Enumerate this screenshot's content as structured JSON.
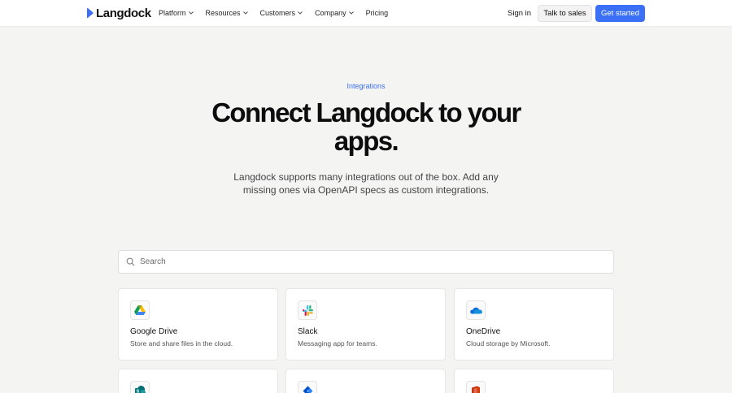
{
  "nav": {
    "logo_text": "Langdock",
    "items": [
      {
        "label": "Platform",
        "has_dropdown": true
      },
      {
        "label": "Resources",
        "has_dropdown": true
      },
      {
        "label": "Customers",
        "has_dropdown": true
      },
      {
        "label": "Company",
        "has_dropdown": true
      },
      {
        "label": "Pricing",
        "has_dropdown": false
      }
    ],
    "sign_in": "Sign in",
    "talk_to_sales": "Talk to sales",
    "get_started": "Get started"
  },
  "hero": {
    "eyebrow": "Integrations",
    "title": "Connect Langdock to your apps.",
    "subtitle": "Langdock supports many integrations out of the box. Add any missing ones via OpenAPI specs as custom integrations."
  },
  "search": {
    "placeholder": "Search"
  },
  "integrations": [
    {
      "name": "Google Drive",
      "description": "Store and share files in the cloud.",
      "icon": "google-drive-icon"
    },
    {
      "name": "Slack",
      "description": "Messaging app for teams.",
      "icon": "slack-icon"
    },
    {
      "name": "OneDrive",
      "description": "Cloud storage by Microsoft.",
      "icon": "onedrive-icon"
    },
    {
      "name": "",
      "description": "",
      "icon": "sharepoint-icon"
    },
    {
      "name": "",
      "description": "",
      "icon": "jira-icon"
    },
    {
      "name": "",
      "description": "",
      "icon": "office-icon"
    }
  ],
  "colors": {
    "accent": "#3b6ff5",
    "background": "#f4f4f3"
  }
}
